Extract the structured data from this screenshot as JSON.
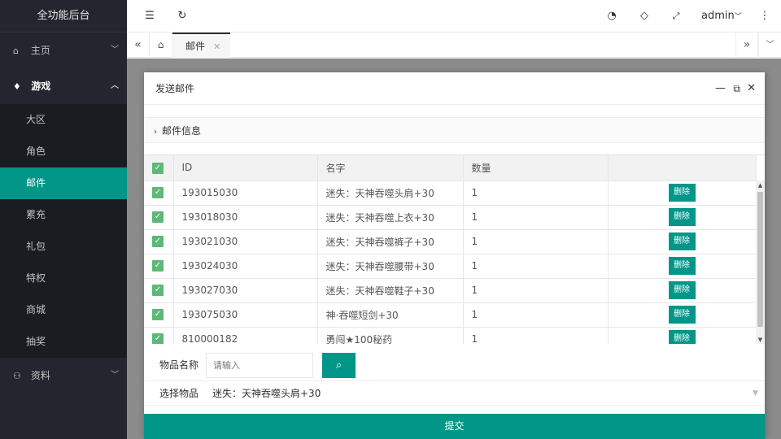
{
  "app": {
    "title": "全功能后台"
  },
  "header": {
    "user": "admin"
  },
  "nav": {
    "home": "主页",
    "game": "游戏",
    "game_items": [
      "大区",
      "角色",
      "邮件",
      "累充",
      "礼包",
      "特权",
      "商城",
      "抽奖"
    ],
    "active_item": "邮件",
    "profile": "资料"
  },
  "tabs": {
    "current": "邮件"
  },
  "modal": {
    "title": "发送邮件",
    "section": "邮件信息",
    "columns": [
      "ID",
      "名字",
      "数量"
    ],
    "rows": [
      {
        "id": "193015030",
        "name": "迷失：天神吞噬头肩+30",
        "qty": "1"
      },
      {
        "id": "193018030",
        "name": "迷失：天神吞噬上衣+30",
        "qty": "1"
      },
      {
        "id": "193021030",
        "name": "迷失：天神吞噬裤子+30",
        "qty": "1"
      },
      {
        "id": "193024030",
        "name": "迷失：天神吞噬腰带+30",
        "qty": "1"
      },
      {
        "id": "193027030",
        "name": "迷失：天神吞噬鞋子+30",
        "qty": "1"
      },
      {
        "id": "193075030",
        "name": "神·吞噬短剑+30",
        "qty": "1"
      },
      {
        "id": "810000182",
        "name": "勇闯★100秘药",
        "qty": "1"
      }
    ],
    "delete_label": "删除",
    "item_name_label": "物品名称",
    "item_name_placeholder": "请输入",
    "select_label": "选择物品",
    "select_value": "迷失：天神吞噬头肩+30",
    "submit_label": "提交"
  },
  "colors": {
    "accent": "#009688",
    "sidebar": "#23262e",
    "check": "#5fb878"
  }
}
